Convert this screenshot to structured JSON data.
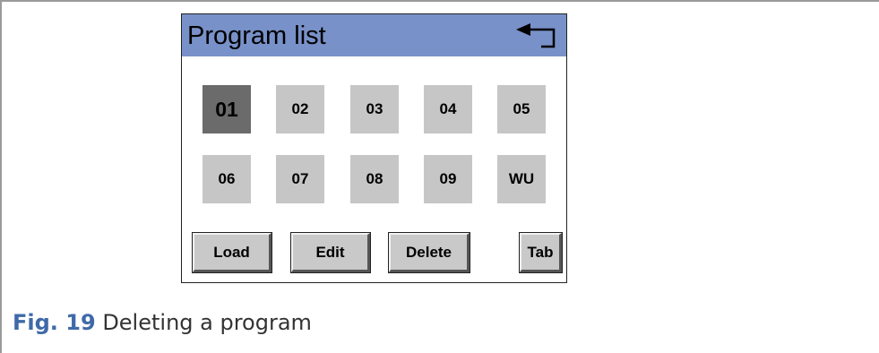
{
  "window": {
    "title": "Program list"
  },
  "programs": [
    "01",
    "02",
    "03",
    "04",
    "05",
    "06",
    "07",
    "08",
    "09",
    "WU"
  ],
  "selected_program": "01",
  "buttons": {
    "load": "Load",
    "edit": "Edit",
    "delete": "Delete",
    "tab": "Tab"
  },
  "caption": {
    "label": "Fig. 19",
    "text": "Deleting a program"
  },
  "colors": {
    "titlebar": "#7891c9",
    "program_tile": "#c6c6c6",
    "program_tile_selected": "#6b6b6b",
    "caption_label": "#3f6aa8"
  },
  "icons": {
    "back": "back-arrow-icon"
  }
}
